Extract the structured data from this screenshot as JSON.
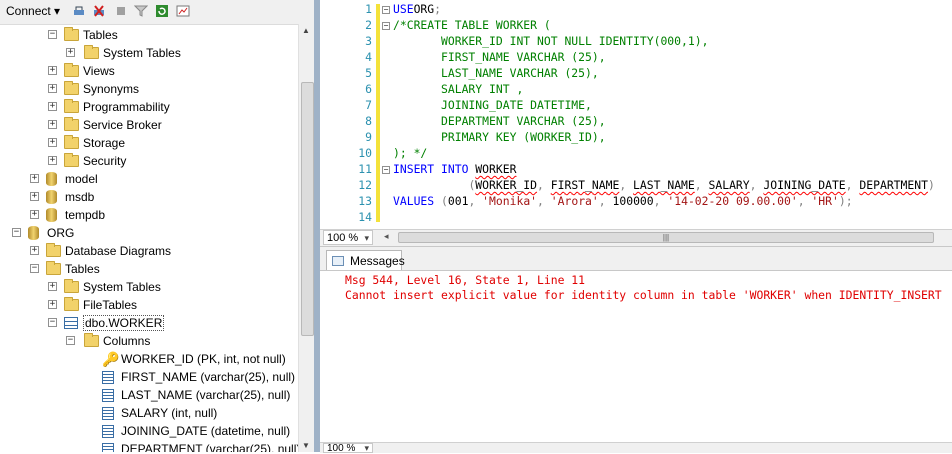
{
  "object_explorer": {
    "toolbar": {
      "connect_label": "Connect",
      "icons": [
        "connect-icon",
        "disconnect-icon",
        "stop-icon",
        "filter-icon",
        "refresh-icon",
        "activity-monitor-icon"
      ]
    },
    "tree": [
      {
        "label": "Tables",
        "kind": "folder",
        "expander": "−"
      },
      {
        "label": "System Tables",
        "kind": "folder",
        "expander": "+"
      },
      {
        "label": "Views",
        "kind": "folder",
        "expander": "+"
      },
      {
        "label": "Synonyms",
        "kind": "folder",
        "expander": "+"
      },
      {
        "label": "Programmability",
        "kind": "folder",
        "expander": "+"
      },
      {
        "label": "Service Broker",
        "kind": "folder",
        "expander": "+"
      },
      {
        "label": "Storage",
        "kind": "folder",
        "expander": "+"
      },
      {
        "label": "Security",
        "kind": "folder",
        "expander": "+"
      },
      {
        "label": "model",
        "kind": "database",
        "expander": "+"
      },
      {
        "label": "msdb",
        "kind": "database",
        "expander": "+"
      },
      {
        "label": "tempdb",
        "kind": "database",
        "expander": "+"
      },
      {
        "label": "ORG",
        "kind": "database",
        "expander": "−"
      },
      {
        "label": "Database Diagrams",
        "kind": "folder",
        "expander": "+"
      },
      {
        "label": "Tables",
        "kind": "folder",
        "expander": "−"
      },
      {
        "label": "System Tables",
        "kind": "folder",
        "expander": "+"
      },
      {
        "label": "FileTables",
        "kind": "folder",
        "expander": "+"
      },
      {
        "label": "dbo.WORKER",
        "kind": "table",
        "expander": "−"
      },
      {
        "label": "Columns",
        "kind": "folder",
        "expander": "−"
      },
      {
        "label": "WORKER_ID (PK, int, not null)",
        "kind": "key",
        "expander": ""
      },
      {
        "label": "FIRST_NAME (varchar(25), null)",
        "kind": "column",
        "expander": ""
      },
      {
        "label": "LAST_NAME (varchar(25), null)",
        "kind": "column",
        "expander": ""
      },
      {
        "label": "SALARY (int, null)",
        "kind": "column",
        "expander": ""
      },
      {
        "label": "JOINING_DATE (datetime, null)",
        "kind": "column",
        "expander": ""
      },
      {
        "label": "DEPARTMENT (varchar(25), null)",
        "kind": "column",
        "expander": ""
      }
    ]
  },
  "editor": {
    "lines": [
      {
        "n": "1",
        "fold": "−",
        "segs": [
          [
            "kw",
            "USE"
          ],
          [
            "",
            "ORG"
          ],
          [
            "gr",
            ";"
          ]
        ]
      },
      {
        "n": "2",
        "fold": "−",
        "segs": [
          [
            "cm",
            "/*CREATE TABLE WORKER ("
          ]
        ]
      },
      {
        "n": "3",
        "fold": "",
        "segs": [
          [
            "cm",
            "       WORKER_ID INT NOT NULL IDENTITY(000,1),"
          ]
        ]
      },
      {
        "n": "4",
        "fold": "",
        "segs": [
          [
            "cm",
            "       FIRST_NAME VARCHAR (25),"
          ]
        ]
      },
      {
        "n": "5",
        "fold": "",
        "segs": [
          [
            "cm",
            "       LAST_NAME VARCHAR (25),"
          ]
        ]
      },
      {
        "n": "6",
        "fold": "",
        "segs": [
          [
            "cm",
            "       SALARY INT ,"
          ]
        ]
      },
      {
        "n": "7",
        "fold": "",
        "segs": [
          [
            "cm",
            "       JOINING_DATE DATETIME,"
          ]
        ]
      },
      {
        "n": "8",
        "fold": "",
        "segs": [
          [
            "cm",
            "       DEPARTMENT VARCHAR (25),"
          ]
        ]
      },
      {
        "n": "9",
        "fold": "",
        "segs": [
          [
            "cm",
            "       PRIMARY KEY (WORKER_ID),"
          ]
        ]
      },
      {
        "n": "10",
        "fold": "",
        "segs": [
          [
            "cm",
            "); */"
          ]
        ]
      },
      {
        "n": "11",
        "fold": "−",
        "segs": [
          [
            "kw",
            "INSERT INTO "
          ],
          [
            "sq",
            "WORKER"
          ]
        ]
      },
      {
        "n": "12",
        "fold": "",
        "segs": [
          [
            "",
            "           "
          ],
          [
            "gr",
            "("
          ],
          [
            "sq",
            "WORKER_ID"
          ],
          [
            "gr",
            ", "
          ],
          [
            "sq",
            "FIRST_NAME"
          ],
          [
            "gr",
            ", "
          ],
          [
            "sq",
            "LAST_NAME"
          ],
          [
            "gr",
            ", "
          ],
          [
            "sq",
            "SALARY"
          ],
          [
            "gr",
            ", "
          ],
          [
            "sq",
            "JOINING_DATE"
          ],
          [
            "gr",
            ", "
          ],
          [
            "sq",
            "DEPARTMENT"
          ],
          [
            "gr",
            ")"
          ]
        ]
      },
      {
        "n": "13",
        "fold": "",
        "segs": [
          [
            "kw",
            "VALUES "
          ],
          [
            "gr",
            "("
          ],
          [
            "",
            "001"
          ],
          [
            "gr",
            ", "
          ],
          [
            "str",
            "'Monika'"
          ],
          [
            "gr",
            ", "
          ],
          [
            "str",
            "'Arora'"
          ],
          [
            "gr",
            ", "
          ],
          [
            "",
            "100000"
          ],
          [
            "gr",
            ", "
          ],
          [
            "str",
            "'14-02-20 09.00.00'"
          ],
          [
            "gr",
            ", "
          ],
          [
            "str",
            "'HR'"
          ],
          [
            "gr",
            ");"
          ]
        ]
      },
      {
        "n": "14",
        "fold": "",
        "segs": []
      }
    ],
    "zoom": "100 %"
  },
  "messages": {
    "tab_label": "Messages",
    "lines": [
      "Msg 544, Level 16, State 1, Line 11",
      "Cannot insert explicit value for identity column in table 'WORKER' when IDENTITY_INSERT"
    ],
    "zoom": "100 %"
  }
}
